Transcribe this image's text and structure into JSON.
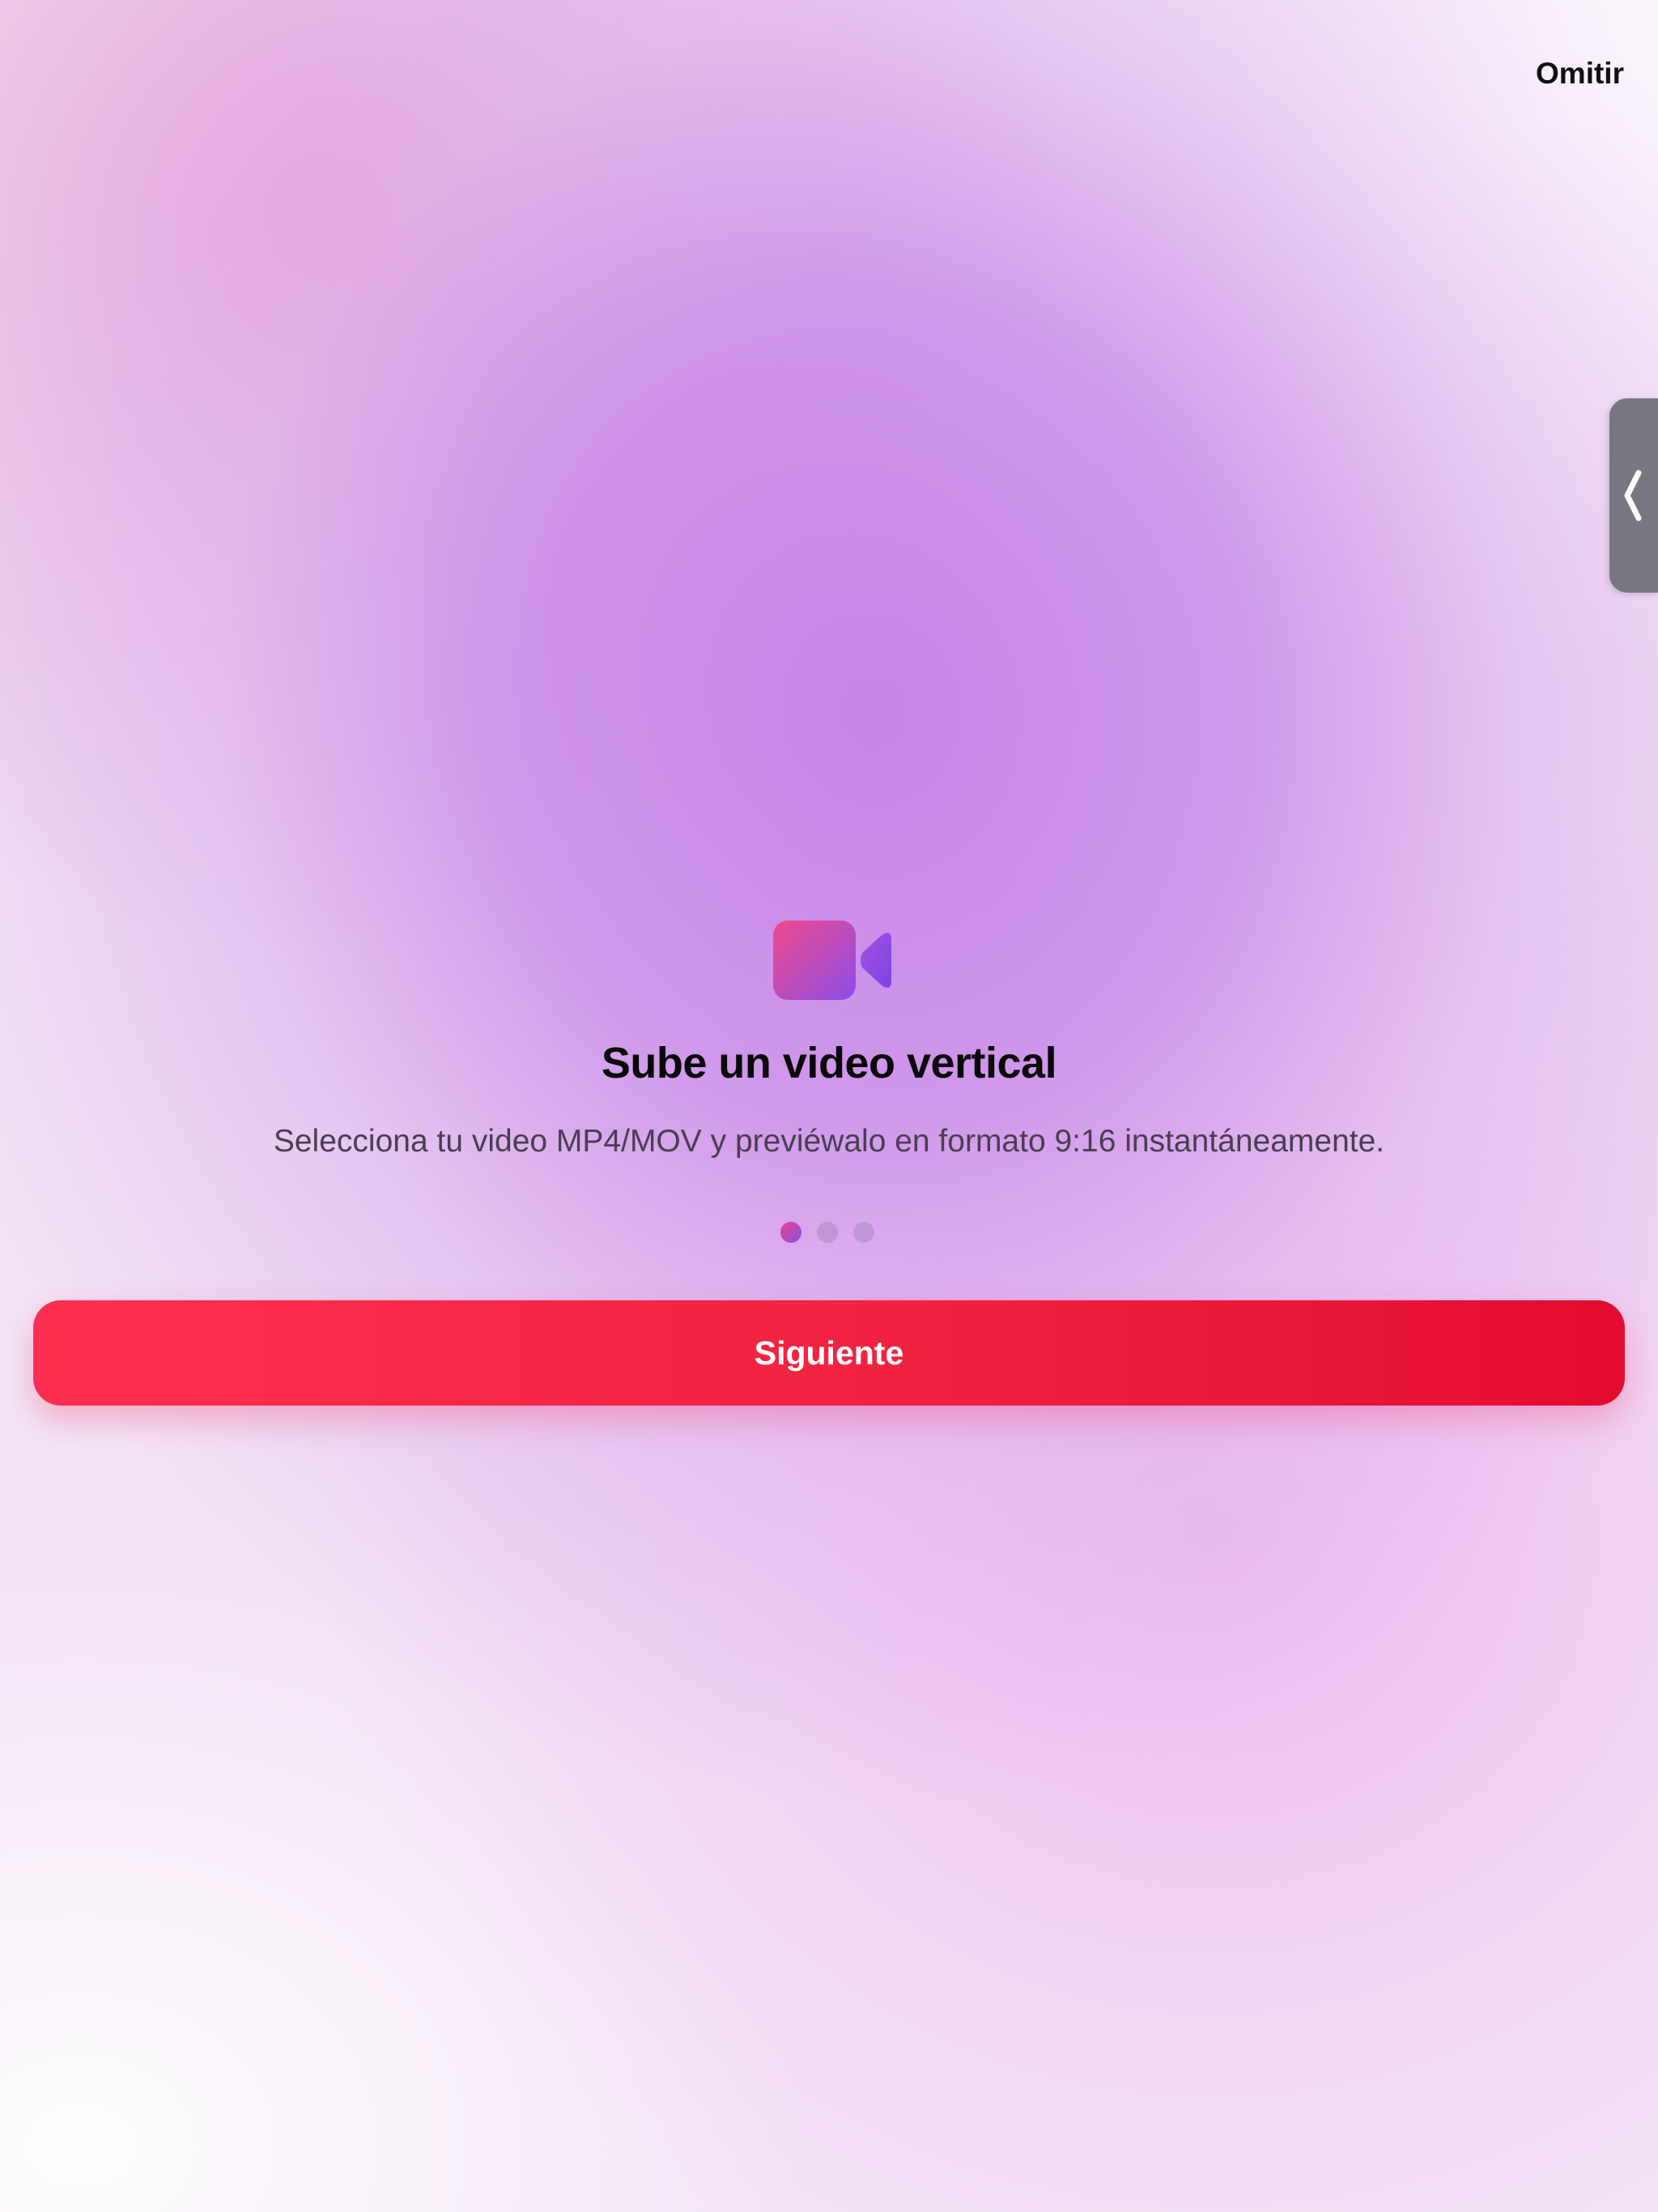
{
  "header": {
    "skip_label": "Omitir"
  },
  "onboarding": {
    "icon": "video-camera-icon",
    "title": "Sube un video vertical",
    "description": "Selecciona tu video MP4/MOV y previéwalo en formato 9:16 instantáneamente.",
    "page_count": 3,
    "current_page": 1,
    "next_label": "Siguiente"
  },
  "side_tab": {
    "icon": "chevron-left-icon"
  },
  "colors": {
    "button_start": "#fd2e4f",
    "button_end": "#e30c30",
    "icon_start": "#f04a8c",
    "icon_end": "#8b4de6"
  }
}
